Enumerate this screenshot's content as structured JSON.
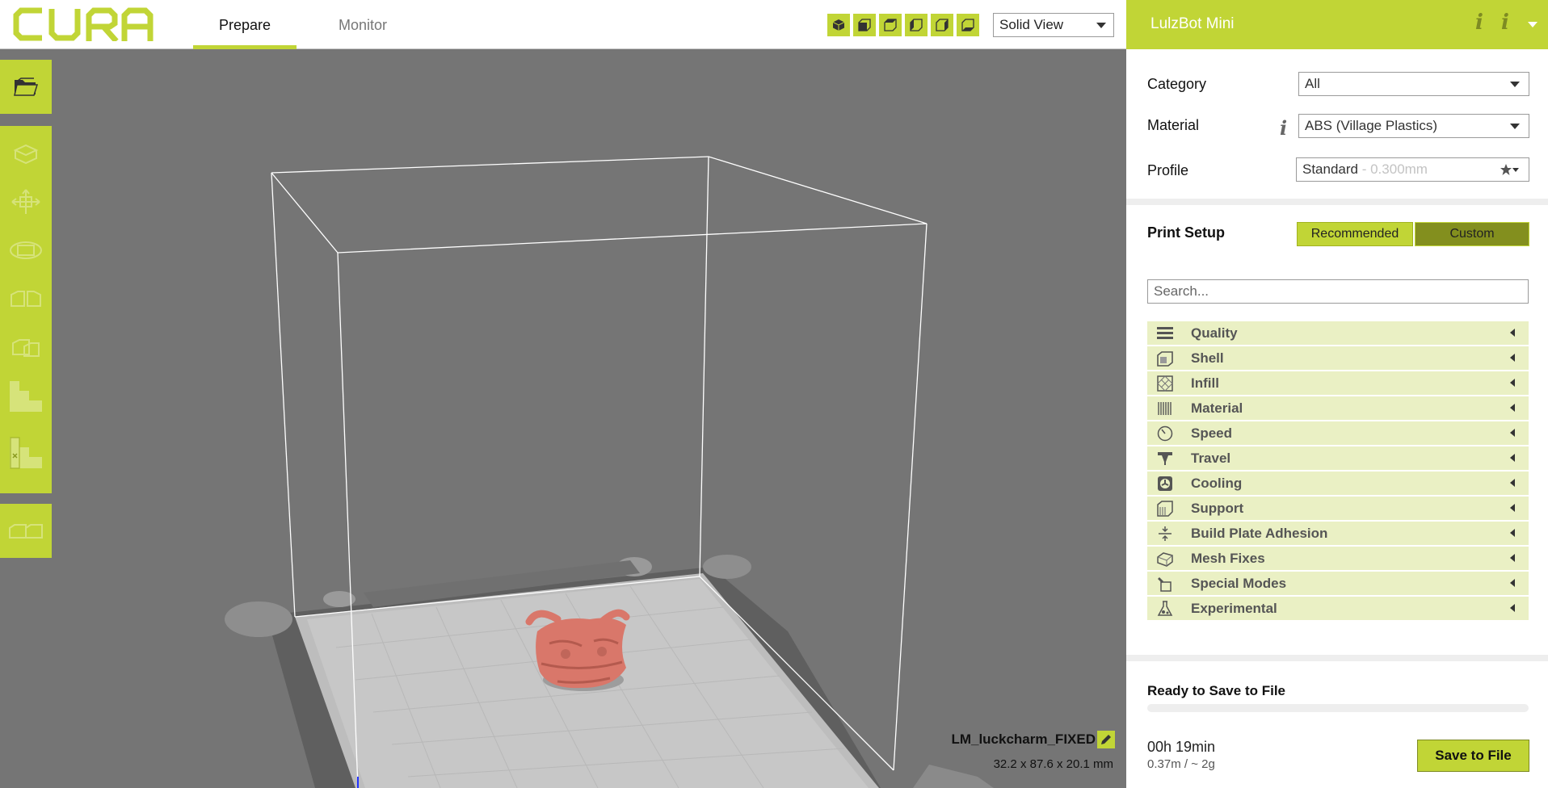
{
  "app": {
    "logo_text": "CURA",
    "accent_color": "#c1d536"
  },
  "header": {
    "tabs": [
      {
        "label": "Prepare",
        "active": true
      },
      {
        "label": "Monitor",
        "active": false
      }
    ],
    "view_buttons": [
      "view-3d-icon",
      "view-front-icon",
      "view-top-icon",
      "view-left-icon",
      "view-right-icon",
      "view-bottom-icon"
    ],
    "view_mode": "Solid View"
  },
  "toolbar": {
    "open_icon": "folder-open-icon",
    "tools": [
      "translate-icon",
      "scale-icon",
      "rotate-icon",
      "mirror-icon",
      "per-model-settings-icon",
      "support-blocker-icon",
      "support-eraser-icon",
      "multiply-icon"
    ]
  },
  "viewport": {
    "object_name": "LM_luckcharm_FIXED",
    "object_dimensions": "32.2 x 87.6 x 20.1 mm"
  },
  "panel": {
    "printer_name": "LulzBot Mini",
    "category": {
      "label": "Category",
      "value": "All"
    },
    "material": {
      "label": "Material",
      "value": "ABS (Village Plastics)"
    },
    "profile": {
      "label": "Profile",
      "value": "Standard",
      "suffix": " - 0.300mm"
    },
    "print_setup": {
      "label": "Print Setup",
      "recommended_label": "Recommended",
      "custom_label": "Custom",
      "search_placeholder": "Search..."
    },
    "categories": [
      {
        "label": "Quality",
        "icon": "quality-icon"
      },
      {
        "label": "Shell",
        "icon": "shell-icon"
      },
      {
        "label": "Infill",
        "icon": "infill-icon"
      },
      {
        "label": "Material",
        "icon": "material-icon"
      },
      {
        "label": "Speed",
        "icon": "speed-icon"
      },
      {
        "label": "Travel",
        "icon": "travel-icon"
      },
      {
        "label": "Cooling",
        "icon": "cooling-icon"
      },
      {
        "label": "Support",
        "icon": "support-icon"
      },
      {
        "label": "Build Plate Adhesion",
        "icon": "adhesion-icon"
      },
      {
        "label": "Mesh Fixes",
        "icon": "mesh-fixes-icon"
      },
      {
        "label": "Special Modes",
        "icon": "special-modes-icon"
      },
      {
        "label": "Experimental",
        "icon": "experimental-icon"
      }
    ],
    "output": {
      "status": "Ready to Save to File",
      "progress": 0,
      "print_time": "00h 19min",
      "usage": "0.37m / ~ 2g",
      "save_label": "Save to File"
    }
  }
}
